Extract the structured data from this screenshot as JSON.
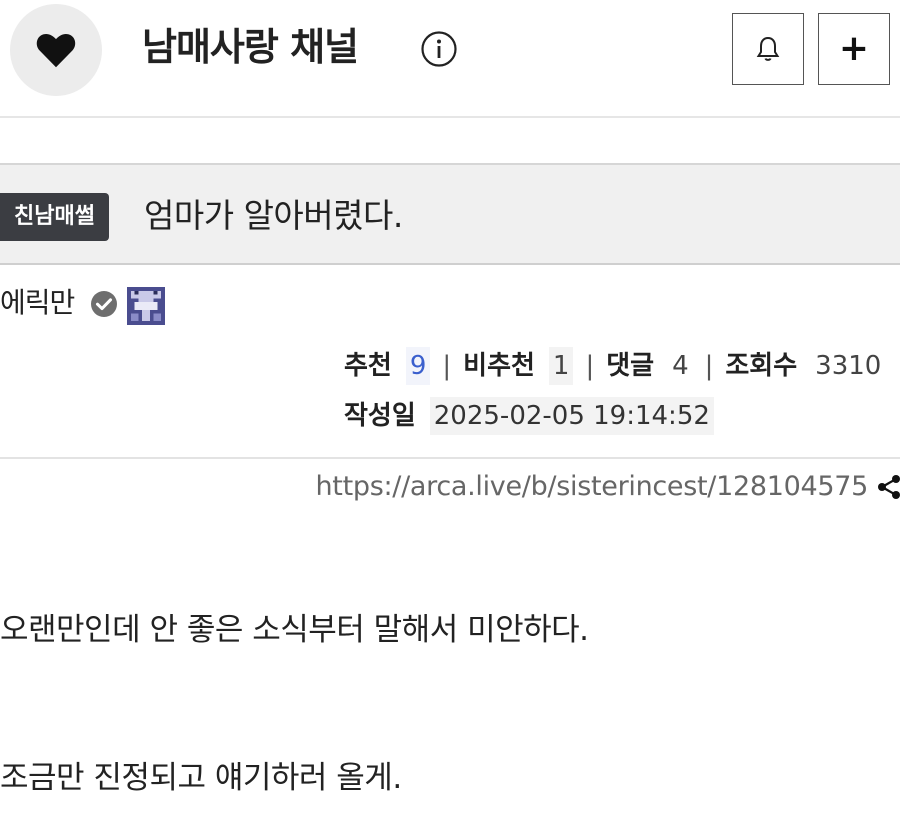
{
  "header": {
    "channel_name": "남매사랑 채널",
    "icon_heart": "heart-icon",
    "icon_info": "info-icon",
    "icon_bell": "bell-icon",
    "plus_label": "+"
  },
  "post": {
    "category": "친남매썰",
    "title": "엄마가 알아버렸다.",
    "author": "에릭만",
    "stats": {
      "recommend_label": "추천",
      "recommend_value": "9",
      "downvote_label": "비추천",
      "downvote_value": "1",
      "comments_label": "댓글",
      "comments_value": "4",
      "views_label": "조회수",
      "views_value": "3310",
      "separator": "|"
    },
    "date_label": "작성일",
    "date_value": "2025-02-05 19:14:52",
    "url": "https://arca.live/b/sisterincest/128104575",
    "body": [
      "오랜만인데 안 좋은 소식부터 말해서 미안하다.",
      "조금만 진정되고 얘기하러 올게."
    ]
  },
  "colors": {
    "accent_blue": "#3a5fcd",
    "badge_bg": "#3b3d42"
  }
}
